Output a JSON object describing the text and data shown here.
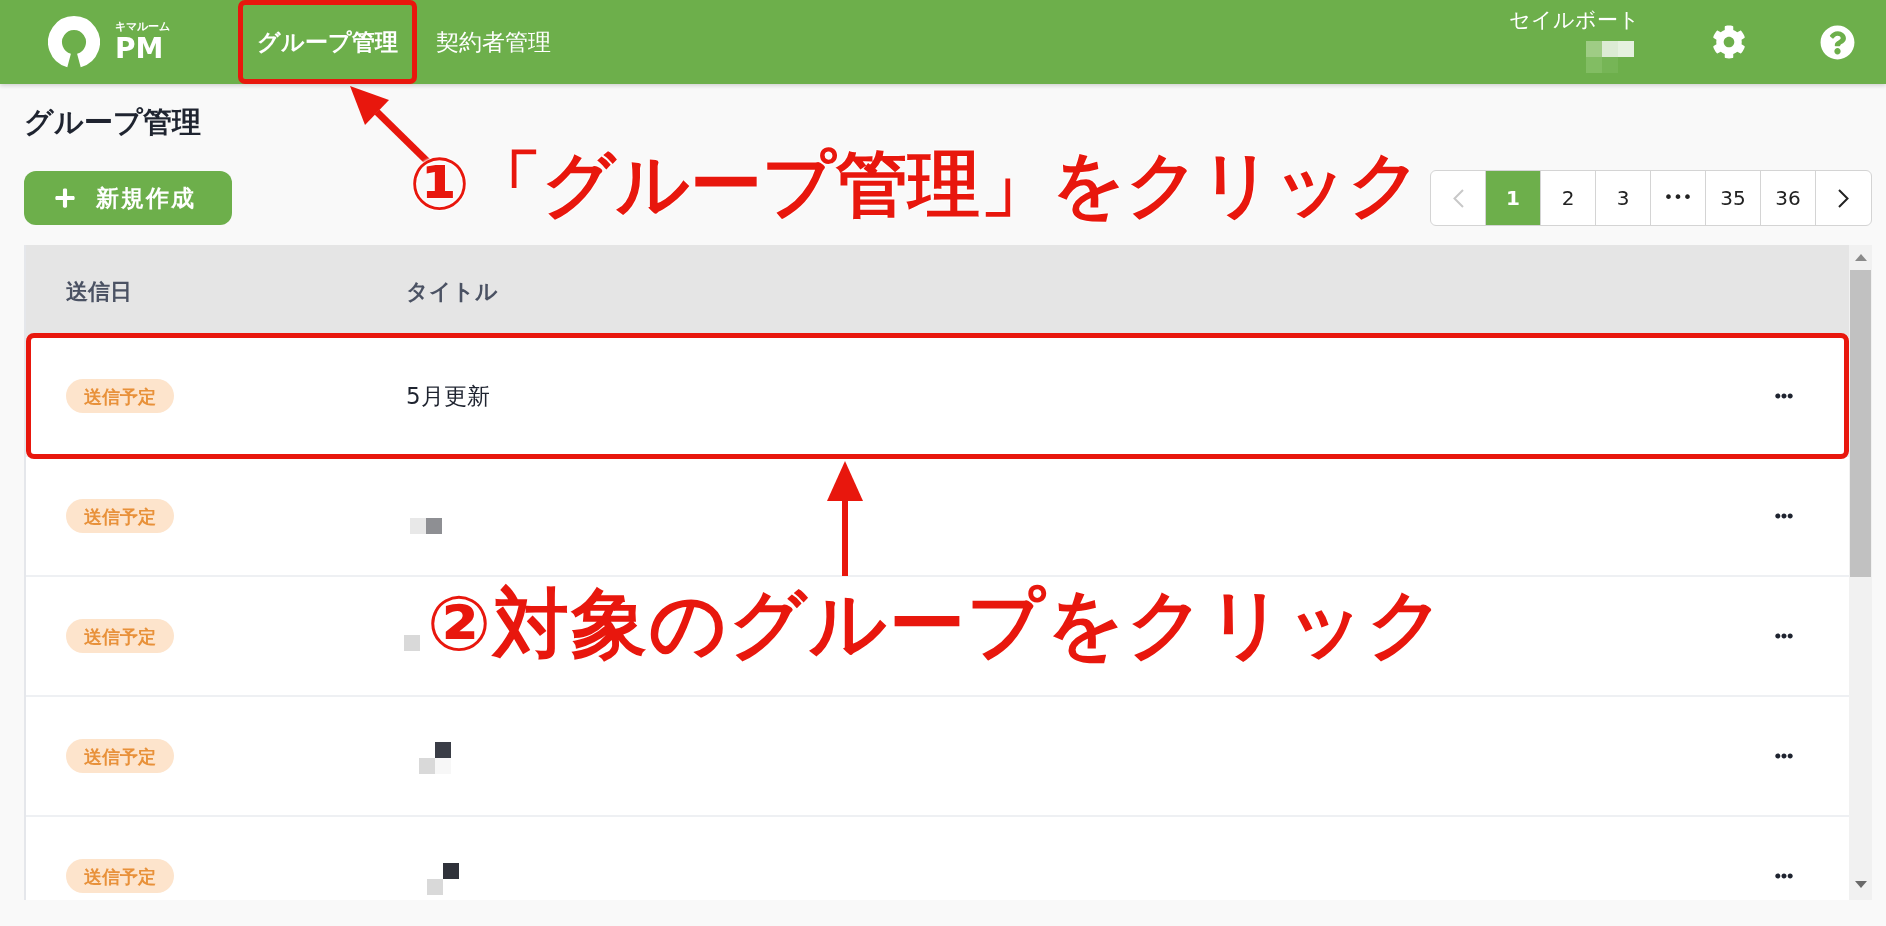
{
  "header": {
    "logo": {
      "caption": "キマルーム",
      "text": "PM"
    },
    "nav": [
      {
        "label": "グループ管理",
        "selected": true,
        "highlighted": true
      },
      {
        "label": "契約者管理",
        "selected": false,
        "highlighted": false
      }
    ],
    "account": {
      "name": "セイルボート",
      "detail_redacted": true
    }
  },
  "page": {
    "title": "グループ管理",
    "new_button": {
      "label": "新規作成"
    }
  },
  "pagination": {
    "prev": {
      "disabled": true
    },
    "pages": [
      {
        "kind": "page",
        "label": "1",
        "selected": true
      },
      {
        "kind": "page",
        "label": "2",
        "selected": false
      },
      {
        "kind": "page",
        "label": "3",
        "selected": false
      },
      {
        "kind": "gap",
        "label": "•••"
      },
      {
        "kind": "page",
        "label": "35",
        "selected": false
      },
      {
        "kind": "page",
        "label": "36",
        "selected": false
      }
    ],
    "next": {
      "disabled": false
    }
  },
  "table": {
    "columns": [
      "送信日",
      "タイトル"
    ],
    "rows": [
      {
        "status": "送信予定",
        "title": "5月更新",
        "redacted": false,
        "highlighted": true
      },
      {
        "status": "送信予定",
        "redacted": true,
        "highlighted": false
      },
      {
        "status": "送信予定",
        "redacted": true,
        "highlighted": false
      },
      {
        "status": "送信予定",
        "redacted": true,
        "highlighted": false
      },
      {
        "status": "送信予定",
        "redacted": true,
        "highlighted": false
      }
    ]
  },
  "annotations": [
    {
      "kind": "header_step",
      "text": "①「グループ管理」をクリック"
    },
    {
      "kind": "row_step",
      "text": "②対象のグループをクリック"
    }
  ]
}
